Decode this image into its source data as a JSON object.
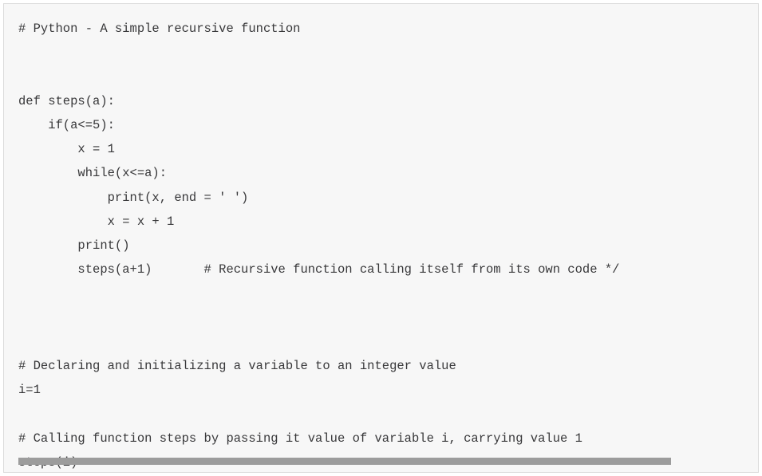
{
  "code": {
    "lines": [
      "# Python - A simple recursive function",
      "",
      "",
      "def steps(a):",
      "    if(a<=5):",
      "        x = 1",
      "        while(x<=a):",
      "            print(x, end = ' ')",
      "            x = x + 1",
      "        print()",
      "        steps(a+1)       # Recursive function calling itself from its own code */",
      "",
      "",
      "",
      "# Declaring and initializing a variable to an integer value",
      "i=1",
      "",
      "# Calling function steps by passing it value of variable i, carrying value 1",
      "steps(i)"
    ]
  }
}
